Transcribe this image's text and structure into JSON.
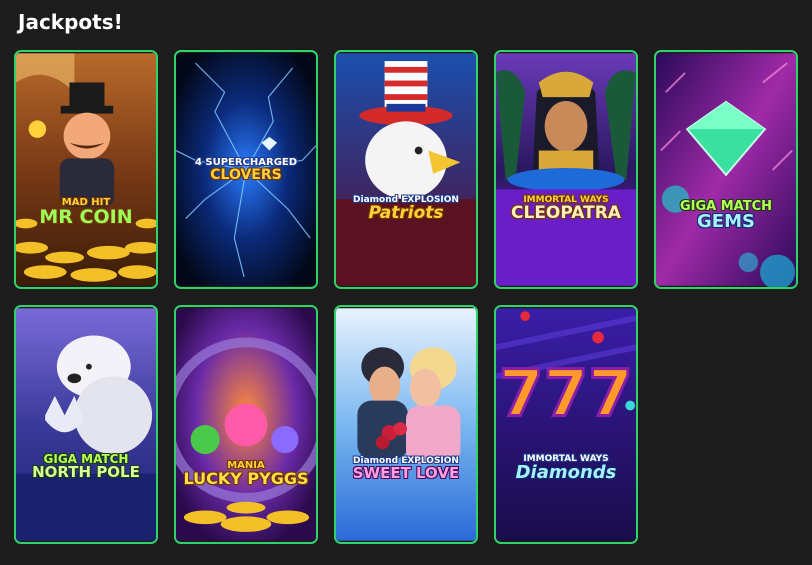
{
  "section": {
    "title": "Jackpots!"
  },
  "colors": {
    "card_border": "#2fd36a",
    "page_background": "#1c1c1c"
  },
  "games": [
    {
      "logo_line1": "MAD HIT",
      "logo_line2": "MR COIN"
    },
    {
      "logo_line1": "4 SUPERCHARGED",
      "logo_line2": "CLOVERS"
    },
    {
      "logo_line1": "Diamond EXPLOSION",
      "logo_line2": "Patriots"
    },
    {
      "logo_line1": "IMMORTAL WAYS",
      "logo_line2": "CLEOPATRA"
    },
    {
      "logo_line1": "GIGA MATCH",
      "logo_line2": "GEMS"
    },
    {
      "logo_line1": "GIGA MATCH",
      "logo_line2": "NORTH POLE"
    },
    {
      "logo_line1": "MANIA",
      "logo_line2": "LUCKY PYGGS"
    },
    {
      "logo_line1": "Diamond EXPLOSION",
      "logo_line2": "SWEET LOVE"
    },
    {
      "logo_line1": "IMMORTAL WAYS",
      "logo_line2": "Diamonds"
    }
  ]
}
